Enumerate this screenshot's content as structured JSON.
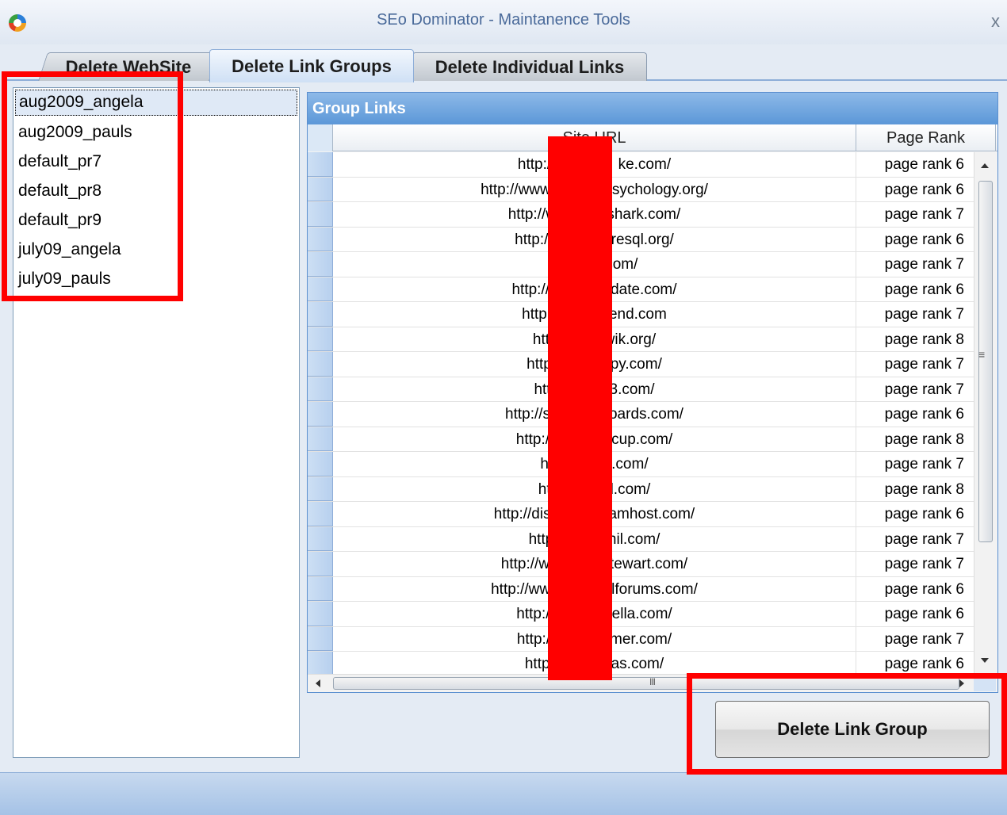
{
  "window": {
    "title": "SEo Dominator - Maintanence Tools",
    "close_glyph": "x"
  },
  "tabs": [
    {
      "label": "Delete WebSite"
    },
    {
      "label": "Delete Link Groups"
    },
    {
      "label": "Delete Individual Links"
    }
  ],
  "groups": [
    "aug2009_angela",
    "aug2009_pauls",
    "default_pr7",
    "default_pr8",
    "default_pr9",
    "july09_angela",
    "july09_pauls"
  ],
  "selected_group": "aug2009_angela",
  "grid": {
    "caption": "Group Links",
    "columns": {
      "url": "Site URL",
      "rank": "Page Rank"
    },
    "rows": [
      {
        "url": "http://               ke.com/",
        "rank": "page rank 6"
      },
      {
        "url": "http://www.c          psychology.org/",
        "rank": "page rank 6"
      },
      {
        "url": "http://w          eshark.com/",
        "rank": "page rank 7"
      },
      {
        "url": "http://p          gresql.org/",
        "rank": "page rank 6"
      },
      {
        "url": "h          .com/",
        "rank": "page rank 7"
      },
      {
        "url": "http://w          pdate.com/",
        "rank": "page rank 6"
      },
      {
        "url": "http://          zend.com",
        "rank": "page rank 7"
      },
      {
        "url": "http:          wik.org/",
        "rank": "page rank 8"
      },
      {
        "url": "http:/          opy.com/",
        "rank": "page rank 7"
      },
      {
        "url": "http          n3.com/",
        "rank": "page rank 7"
      },
      {
        "url": "http://su          boards.com/",
        "rank": "page rank 6"
      },
      {
        "url": "http://v          ecup.com/",
        "rank": "page rank 8"
      },
      {
        "url": "htt          nt.com/",
        "rank": "page rank 7"
      },
      {
        "url": "http          d.com/",
        "rank": "page rank 8"
      },
      {
        "url": "http://disc          eamhost.com/",
        "rank": "page rank 6"
      },
      {
        "url": "http:          phil.com/",
        "rank": "page rank 7"
      },
      {
        "url": "http://ww          stewart.com/",
        "rank": "page rank 7"
      },
      {
        "url": "http://www          alforums.com/",
        "rank": "page rank 6"
      },
      {
        "url": "http://v          hella.com/",
        "rank": "page rank 6"
      },
      {
        "url": "http://p          rmer.com/",
        "rank": "page rank 7"
      },
      {
        "url": "http:/          sias.com/",
        "rank": "page rank 6"
      }
    ]
  },
  "scrollbar": {
    "vertical_grip": "≡",
    "horizontal_grip": "III"
  },
  "buttons": {
    "delete_label": "Delete Link Group"
  },
  "annotations": {
    "highlight_color": "#ff0000",
    "redaction_color": "#ff0000"
  }
}
